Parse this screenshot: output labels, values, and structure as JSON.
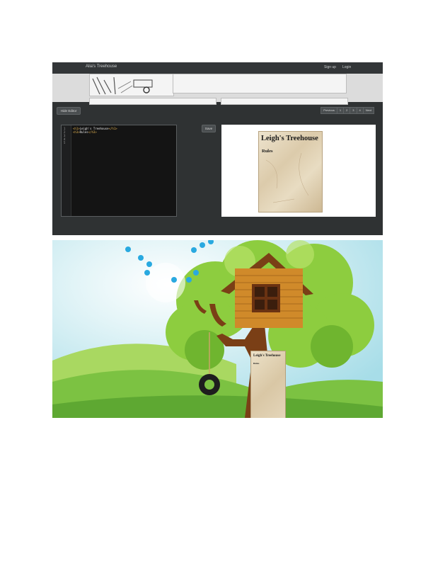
{
  "app": {
    "brand": "Alia's Treehouse",
    "nav": {
      "signup": "Sign up",
      "login": "Login"
    }
  },
  "toolbar": {
    "hide_editor": "Hide Editor",
    "save": "Save",
    "pagination": [
      "Previous",
      "1",
      "2",
      "3",
      "4",
      "Next"
    ]
  },
  "editor": {
    "line_numbers": [
      "1",
      "2",
      "3",
      "4",
      "5"
    ],
    "lines": [
      {
        "open": "<h1>",
        "text": "Leigh's Treehouse",
        "close": "</h1>"
      },
      {
        "open": "<h3>",
        "text": "Rules",
        "close": "</h3>"
      },
      {
        "open": "",
        "text": "",
        "close": ""
      },
      {
        "open": "",
        "text": "",
        "close": ""
      },
      {
        "open": "",
        "text": "",
        "close": ""
      }
    ]
  },
  "preview": {
    "heading": "Leigh's Treehouse",
    "subheading": "Rules"
  },
  "scene": {
    "sign_heading": "Leigh's Treehouse",
    "sign_subheading": "Rules"
  },
  "colors": {
    "app_bg": "#2f3233",
    "navbar_bg": "#333638",
    "editor_bg": "#141414",
    "code_tag": "#e0b050",
    "bird": "#29a9e0",
    "grass": "#7cc242",
    "trunk": "#7a3f16",
    "house": "#d08a2a"
  },
  "icons": [
    "bird-icon",
    "tire-swing-icon",
    "treehouse-illustration"
  ]
}
